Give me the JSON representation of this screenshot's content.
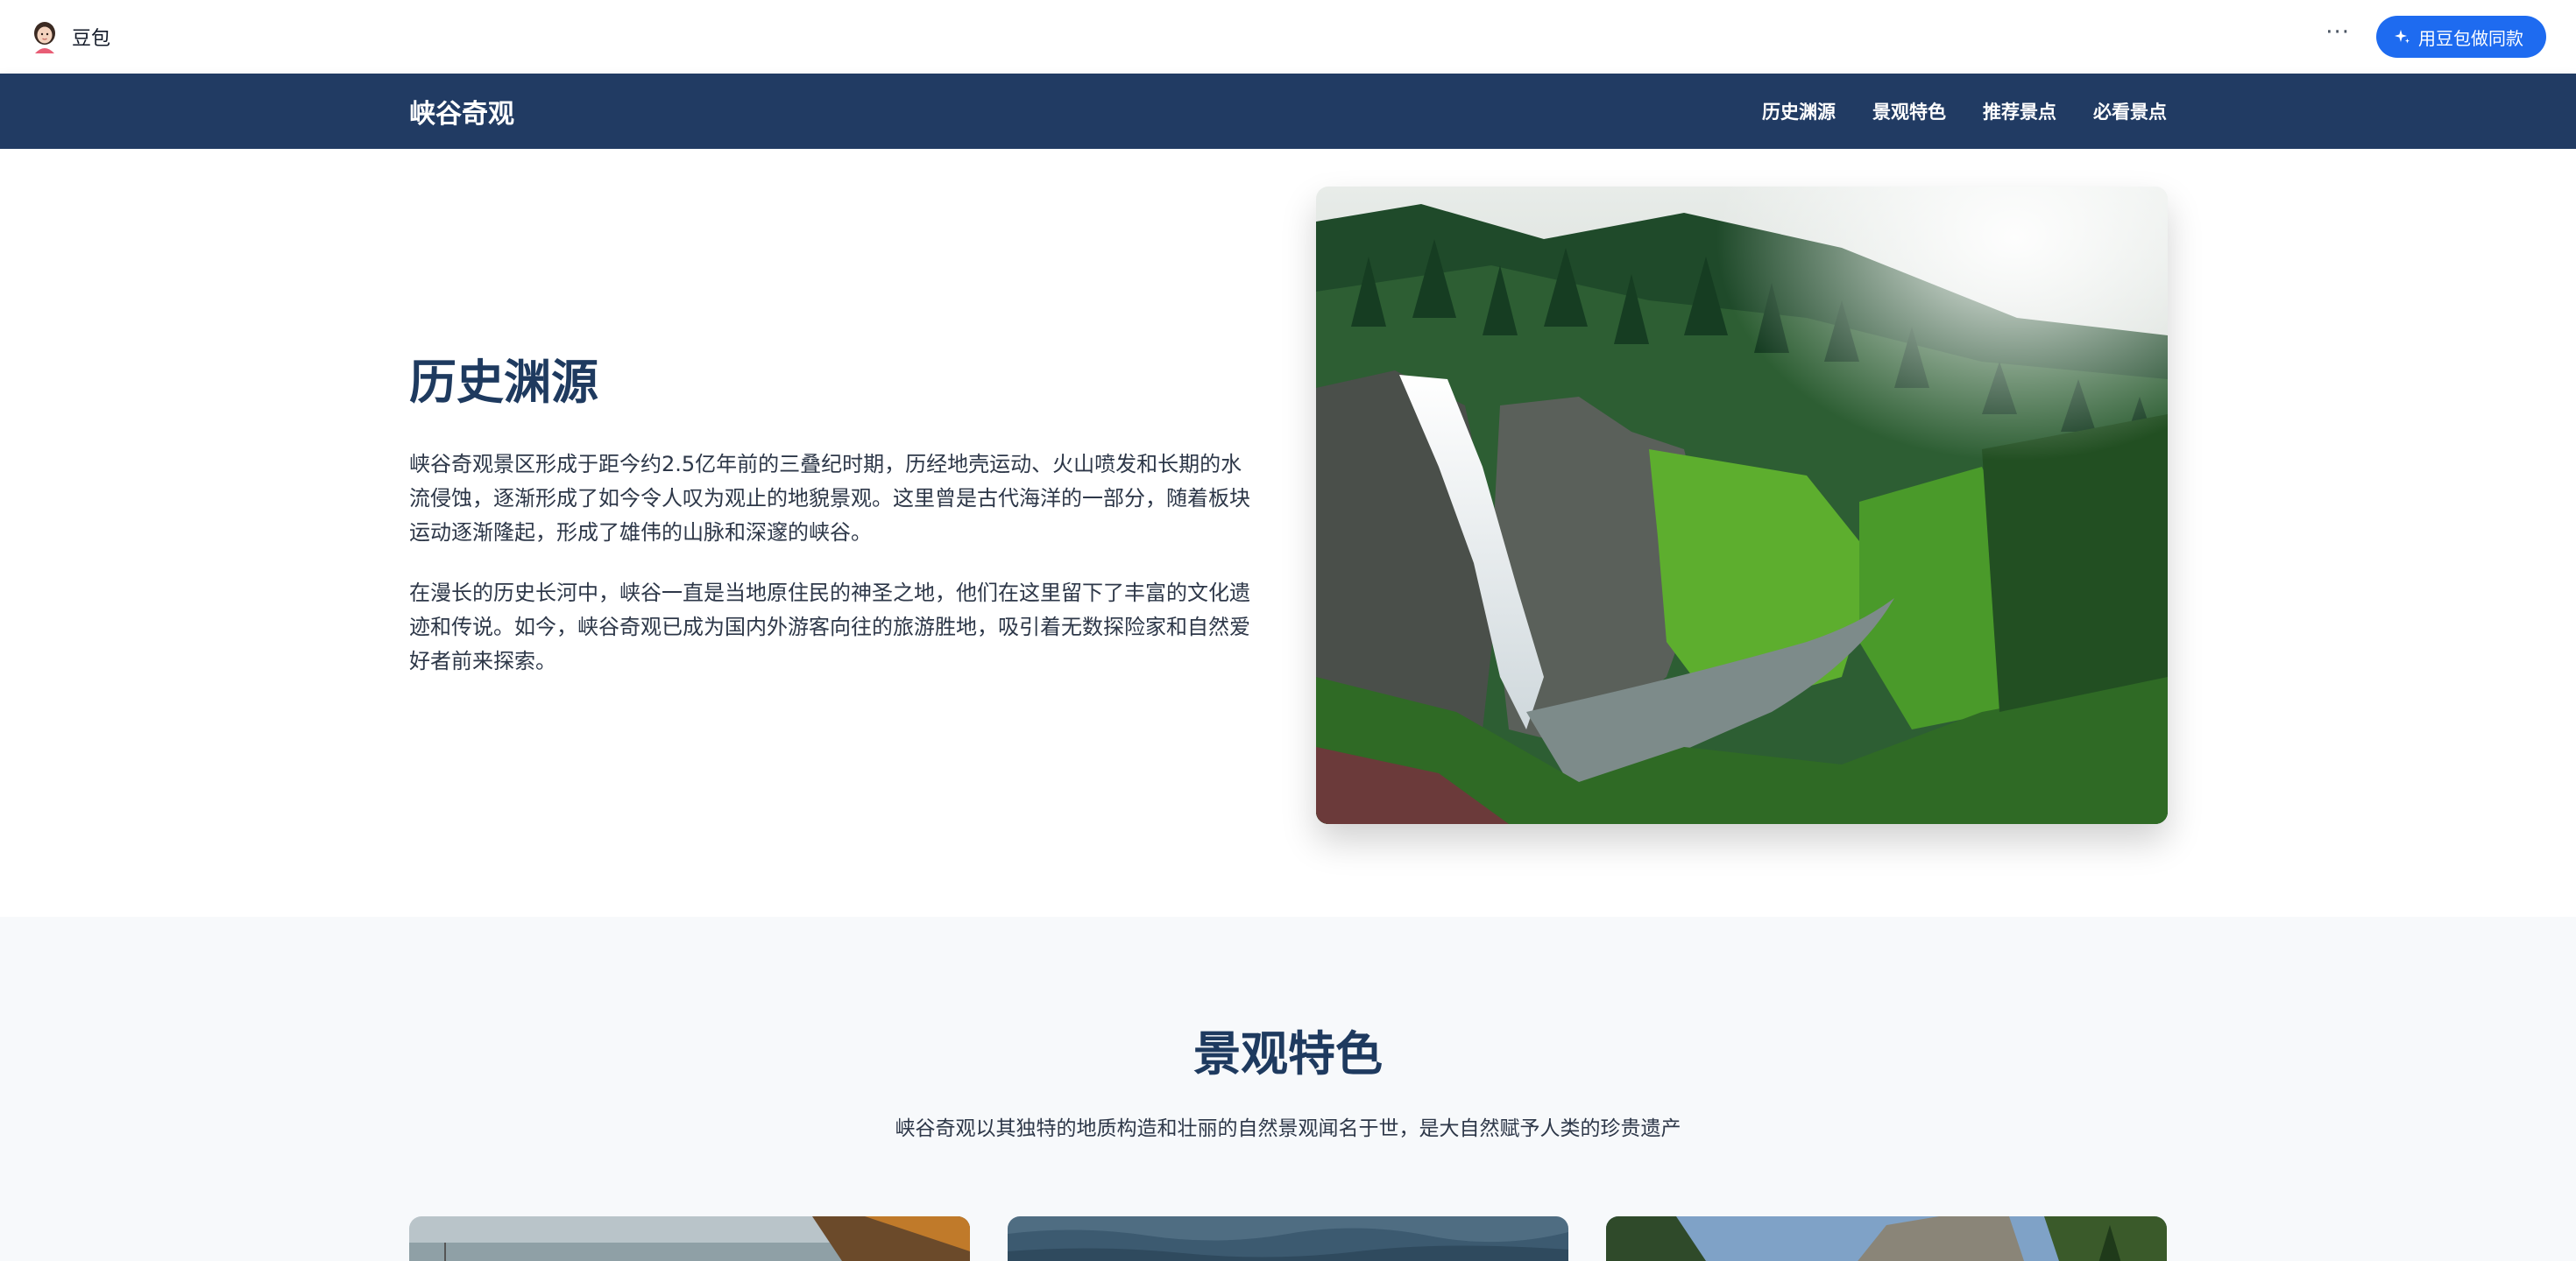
{
  "app": {
    "name": "豆包",
    "more_label": "···",
    "make_button_label": "用豆包做同款"
  },
  "site": {
    "brand": "峡谷奇观",
    "nav": [
      "历史渊源",
      "景观特色",
      "推荐景点",
      "必看景点"
    ]
  },
  "history": {
    "title": "历史渊源",
    "paragraphs": [
      "峡谷奇观景区形成于距今约2.5亿年前的三叠纪时期，历经地壳运动、火山喷发和长期的水流侵蚀，逐渐形成了如今令人叹为观止的地貌景观。这里曾是古代海洋的一部分，随着板块运动逐渐隆起，形成了雄伟的山脉和深邃的峡谷。",
      "在漫长的历史长河中，峡谷一直是当地原住民的神圣之地，他们在这里留下了丰富的文化遗迹和传说。如今，峡谷奇观已成为国内外游客向往的旅游胜地，吸引着无数探险家和自然爱好者前来探索。"
    ]
  },
  "features": {
    "title": "景观特色",
    "subtitle": "峡谷奇观以其独特的地质构造和壮丽的自然景观闻名于世，是大自然赋予人类的珍贵遗产"
  },
  "colors": {
    "nav_bg": "#213b63",
    "heading": "#1e3a5f",
    "accent_button": "#1e6bf0",
    "features_bg": "#f7f9fb"
  }
}
